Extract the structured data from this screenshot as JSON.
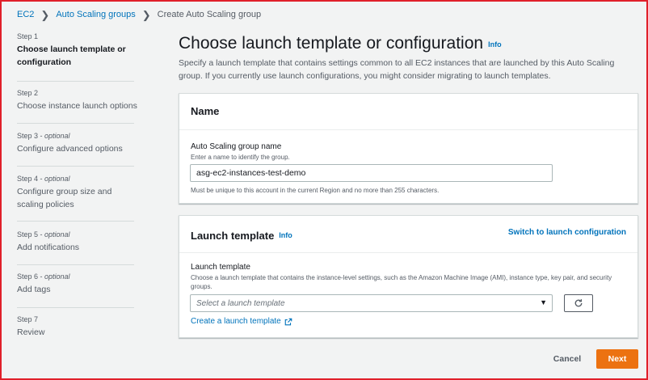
{
  "breadcrumb": {
    "items": [
      "EC2",
      "Auto Scaling groups"
    ],
    "current": "Create Auto Scaling group",
    "separator": "❯"
  },
  "steps": [
    {
      "num": "Step 1",
      "optional": "",
      "title_lines": [
        "Choose launch template or",
        "configuration"
      ],
      "active": true
    },
    {
      "num": "Step 2",
      "optional": "",
      "title_lines": [
        "Choose instance launch options"
      ],
      "active": false
    },
    {
      "num": "Step 3 - ",
      "optional": "optional",
      "title_lines": [
        "Configure advanced options"
      ],
      "active": false
    },
    {
      "num": "Step 4 - ",
      "optional": "optional",
      "title_lines": [
        "Configure group size and",
        "scaling policies"
      ],
      "active": false
    },
    {
      "num": "Step 5 - ",
      "optional": "optional",
      "title_lines": [
        "Add notifications"
      ],
      "active": false
    },
    {
      "num": "Step 6 - ",
      "optional": "optional",
      "title_lines": [
        "Add tags"
      ],
      "active": false
    },
    {
      "num": "Step 7",
      "optional": "",
      "title_lines": [
        "Review"
      ],
      "active": false
    }
  ],
  "page": {
    "title": "Choose launch template or configuration",
    "info": "Info",
    "description": "Specify a launch template that contains settings common to all EC2 instances that are launched by this Auto Scaling group. If you currently use launch configurations, you might consider migrating to launch templates."
  },
  "name_panel": {
    "title": "Name",
    "field_label": "Auto Scaling group name",
    "field_hint": "Enter a name to identify the group.",
    "field_value": "asg-ec2-instances-test-demo",
    "field_constraint": "Must be unique to this account in the current Region and no more than 255 characters."
  },
  "launch_panel": {
    "title": "Launch template",
    "info": "Info",
    "switch_link": "Switch to launch configuration",
    "field_label": "Launch template",
    "field_hint": "Choose a launch template that contains the instance-level settings, such as the Amazon Machine Image (AMI), instance type, key pair, and security groups.",
    "select_placeholder": "Select a launch template",
    "create_link": "Create a launch template"
  },
  "footer": {
    "cancel": "Cancel",
    "next": "Next"
  },
  "colors": {
    "link": "#0073bb",
    "primary_button": "#ec7211",
    "frame_border": "#e0202a"
  }
}
